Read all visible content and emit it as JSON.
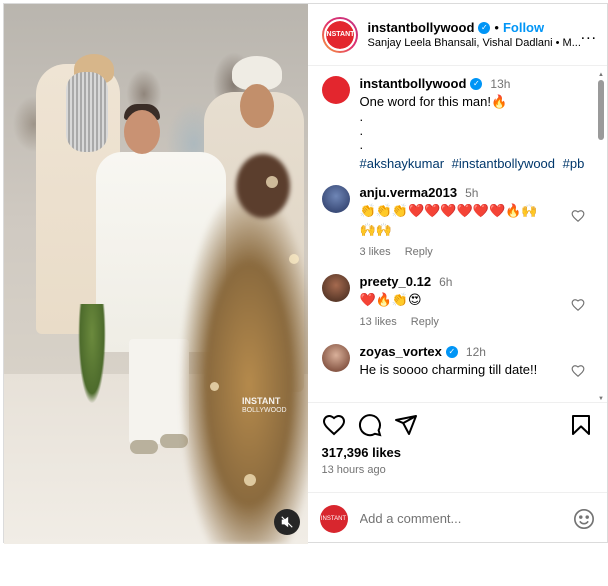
{
  "post": {
    "username": "instantbollywood",
    "follow_label": "Follow",
    "subtitle": "Sanjay Leela Bhansali, Vishal Dadlani • M...",
    "avatar_text": "INSTANT",
    "more_label": "...",
    "watermark_line1": "INSTANT",
    "watermark_line2": "BOLLYWOOD"
  },
  "caption": {
    "username": "instantbollywood",
    "time": "13h",
    "text": "One word for this man!🔥",
    "dots": [
      ".",
      ".",
      "."
    ],
    "hashtags": [
      "#akshaykumar",
      "#instantbollywood",
      "#pb"
    ]
  },
  "comments": [
    {
      "username": "anju.verma2013",
      "time": "5h",
      "text_line1": "👏👏👏❤️❤️❤️❤️❤️❤️🔥🙌",
      "text_line2": "🙌🙌",
      "likes": "3 likes",
      "reply": "Reply"
    },
    {
      "username": "preety_0.12",
      "time": "6h",
      "text_line1": "❤️🔥👏😍",
      "likes": "13 likes",
      "reply": "Reply"
    },
    {
      "username": "zoyas_vortex",
      "time": "12h",
      "text_line1": "He is soooo charming till date!!"
    }
  ],
  "actions": {
    "likes": "317,396 likes",
    "time_ago": "13 hours ago"
  },
  "add_comment": {
    "placeholder": "Add a comment...",
    "avatar_text": "INSTANT"
  },
  "colors": {
    "link_blue": "#0095f6",
    "hashtag": "#00376b",
    "muted_text": "#737373",
    "avatar_red": "#e3262e"
  },
  "icons": [
    "heart-icon",
    "comment-icon",
    "share-icon",
    "bookmark-icon",
    "emoji-icon",
    "mute-icon",
    "verified-icon",
    "more-icon"
  ]
}
